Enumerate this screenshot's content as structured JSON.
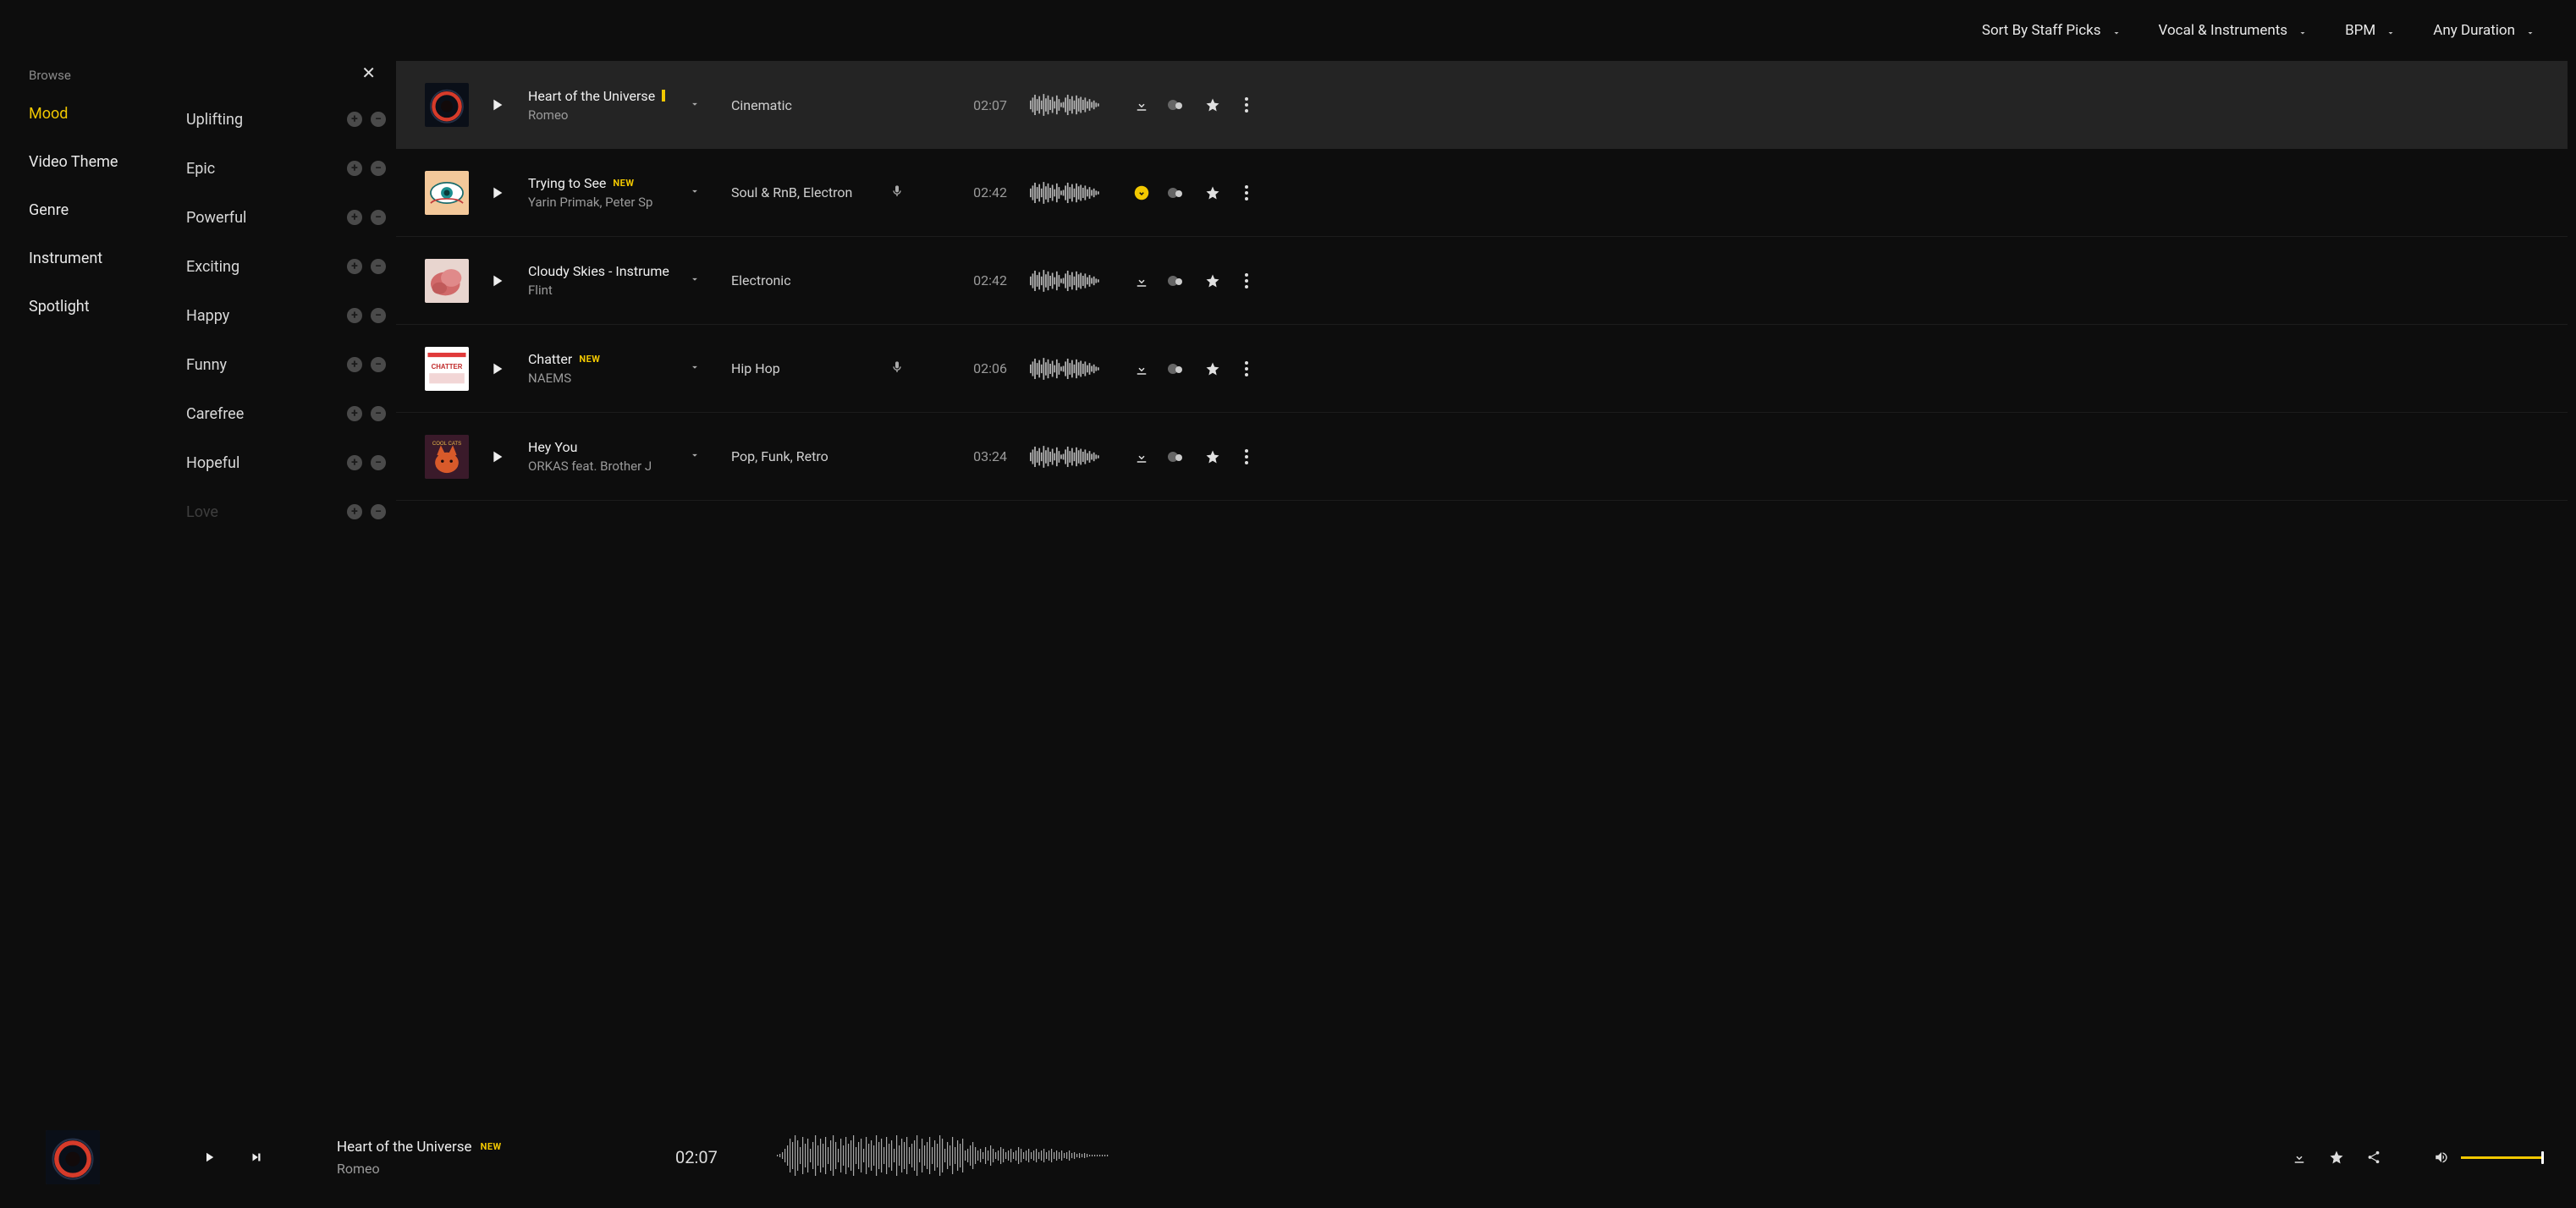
{
  "filters": {
    "sort": "Sort By Staff Picks",
    "vocal": "Vocal & Instruments",
    "bpm": "BPM",
    "duration": "Any Duration"
  },
  "nav": {
    "browse_label": "Browse",
    "items": [
      "Mood",
      "Video Theme",
      "Genre",
      "Instrument",
      "Spotlight"
    ],
    "active_index": 0
  },
  "moods": [
    "Uplifting",
    "Epic",
    "Powerful",
    "Exciting",
    "Happy",
    "Funny",
    "Carefree",
    "Hopeful",
    "Love"
  ],
  "badges": {
    "new": "NEW"
  },
  "tracks": [
    {
      "title": "Heart of the Universe",
      "artist": "Romeo",
      "genre": "Cinematic",
      "duration": "02:07",
      "has_mic": false,
      "has_dashline": true,
      "is_new": false,
      "highlight": true,
      "download_accent": false
    },
    {
      "title": "Trying to See",
      "artist": "Yarin Primak, Peter Sp",
      "genre": "Soul & RnB, Electron",
      "duration": "02:42",
      "has_mic": true,
      "has_dashline": false,
      "is_new": true,
      "highlight": false,
      "download_accent": true
    },
    {
      "title": "Cloudy Skies - Instrume",
      "artist": "Flint",
      "genre": "Electronic",
      "duration": "02:42",
      "has_mic": false,
      "has_dashline": false,
      "is_new": false,
      "highlight": false,
      "download_accent": false
    },
    {
      "title": "Chatter",
      "artist": "NAEMS",
      "genre": "Hip Hop",
      "duration": "02:06",
      "has_mic": true,
      "has_dashline": false,
      "is_new": true,
      "highlight": false,
      "download_accent": false
    },
    {
      "title": "Hey You",
      "artist": "ORKAS feat. Brother J",
      "genre": "Pop, Funk, Retro",
      "duration": "03:24",
      "has_mic": false,
      "has_dashline": false,
      "is_new": false,
      "highlight": false,
      "download_accent": false
    }
  ],
  "player": {
    "title": "Heart of the Universe",
    "artist": "Romeo",
    "time": "02:07",
    "is_new": true
  },
  "icons": {
    "plus": "+",
    "minus": "−",
    "close": "✕"
  }
}
